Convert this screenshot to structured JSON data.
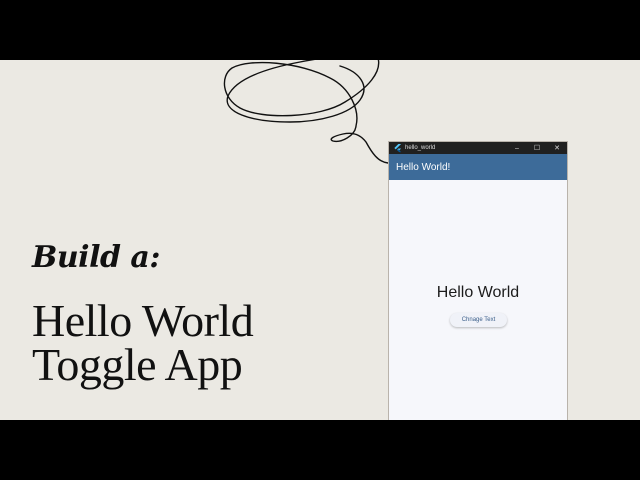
{
  "slide": {
    "subtitle": "Build a:",
    "title_line1": "Hello World",
    "title_line2": "Toggle App",
    "background_color": "#ebe9e3"
  },
  "window": {
    "title": "hello_world",
    "icon": "flutter-icon",
    "controls": {
      "minimize": "–",
      "maximize": "☐",
      "close": "✕"
    },
    "appbar_title": "Hello World!",
    "appbar_color": "#3d6b99",
    "body_text": "Hello World",
    "button_label": "Chnage Text"
  }
}
